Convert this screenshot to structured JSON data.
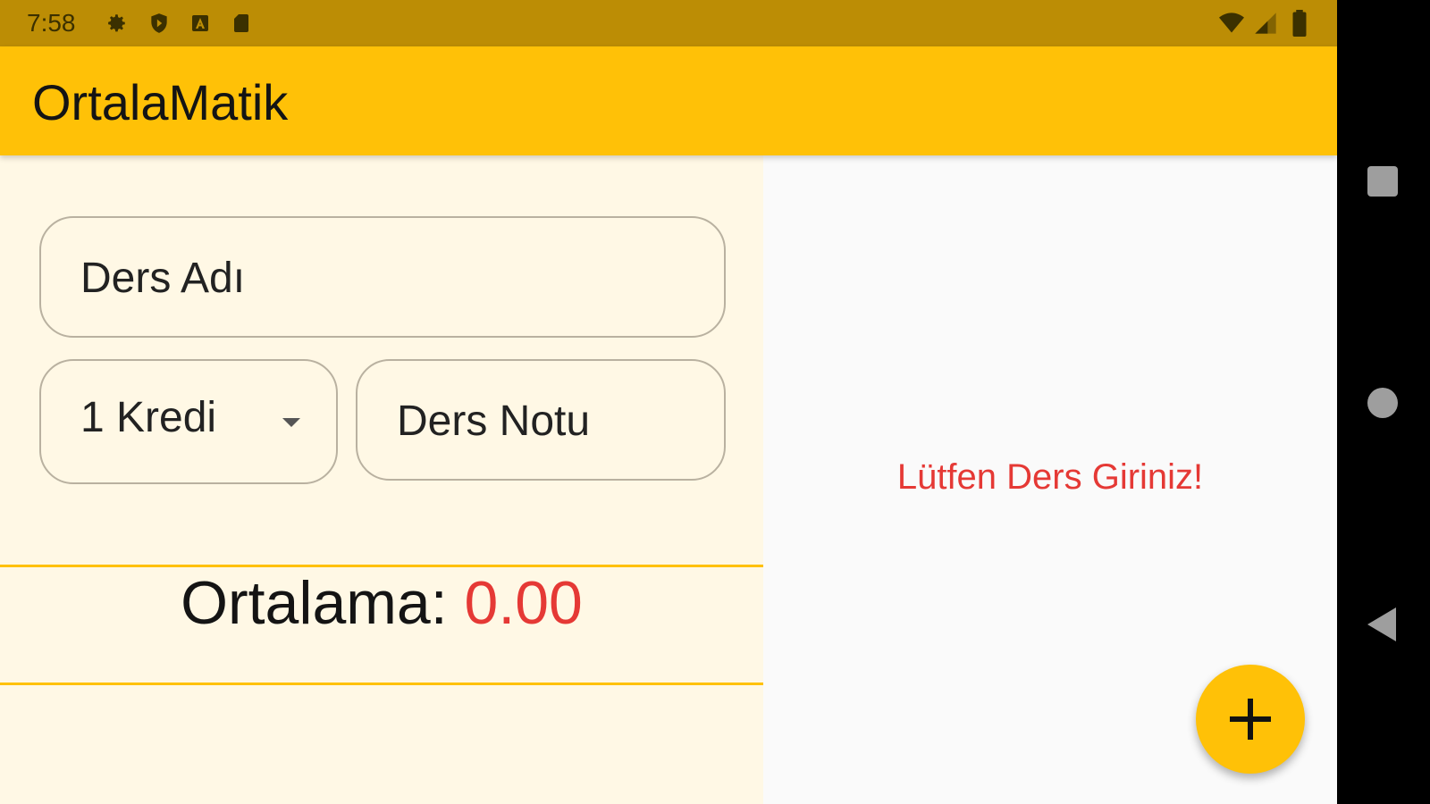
{
  "status_bar": {
    "time": "7:58",
    "left_icons": [
      "gear-icon",
      "shield-icon",
      "a-box-icon",
      "sd-card-icon"
    ],
    "right_icons": [
      "wifi-icon",
      "signal-icon",
      "battery-icon"
    ],
    "background": "#bc8d05"
  },
  "app_bar": {
    "title": "OrtalaMatik",
    "background": "#ffc107"
  },
  "form": {
    "course_name_placeholder": "Ders Adı",
    "credit_selected": "1 Kredi",
    "grade_placeholder": "Ders Notu"
  },
  "average": {
    "label": "Ortalama: ",
    "value": "0.00",
    "value_color": "#e53935"
  },
  "list": {
    "empty_message": "Lütfen Ders Giriniz!"
  },
  "fab": {
    "icon": "plus-icon"
  },
  "nav_bar": {
    "buttons": [
      "recents-icon",
      "home-icon",
      "back-icon"
    ]
  }
}
